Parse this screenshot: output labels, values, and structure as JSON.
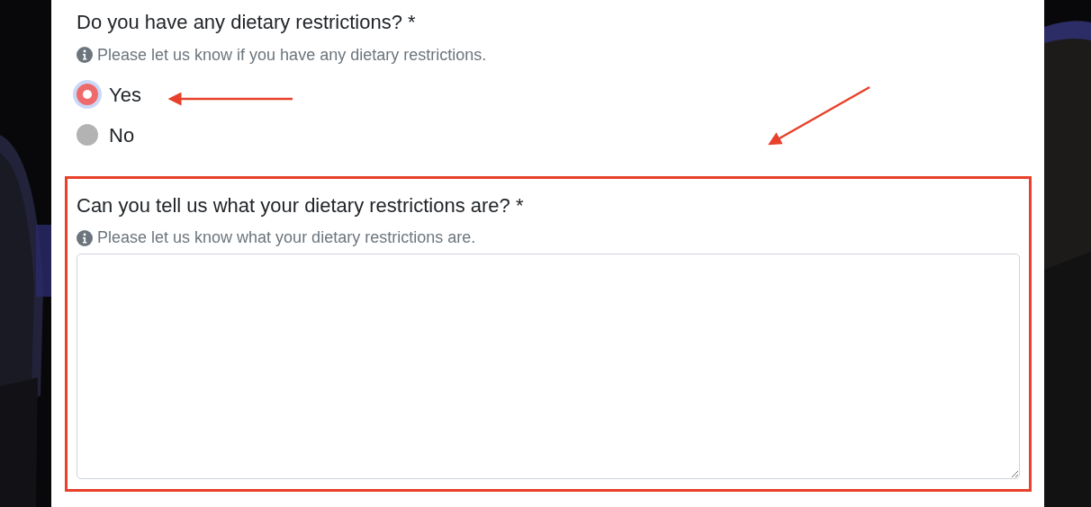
{
  "questions": [
    {
      "kind": "radio",
      "label": "Do you have any dietary restrictions? *",
      "help": "Please let us know if you have any dietary restrictions.",
      "highlighted": false,
      "options": [
        {
          "label": "Yes",
          "selected": true
        },
        {
          "label": "No",
          "selected": false
        }
      ]
    },
    {
      "kind": "textarea",
      "label": "Can you tell us what your dietary restrictions are? *",
      "help": "Please let us know what your dietary restrictions are.",
      "highlighted": true
    }
  ],
  "annotations": [
    {
      "kind": "arrow"
    },
    {
      "kind": "arrow"
    }
  ]
}
